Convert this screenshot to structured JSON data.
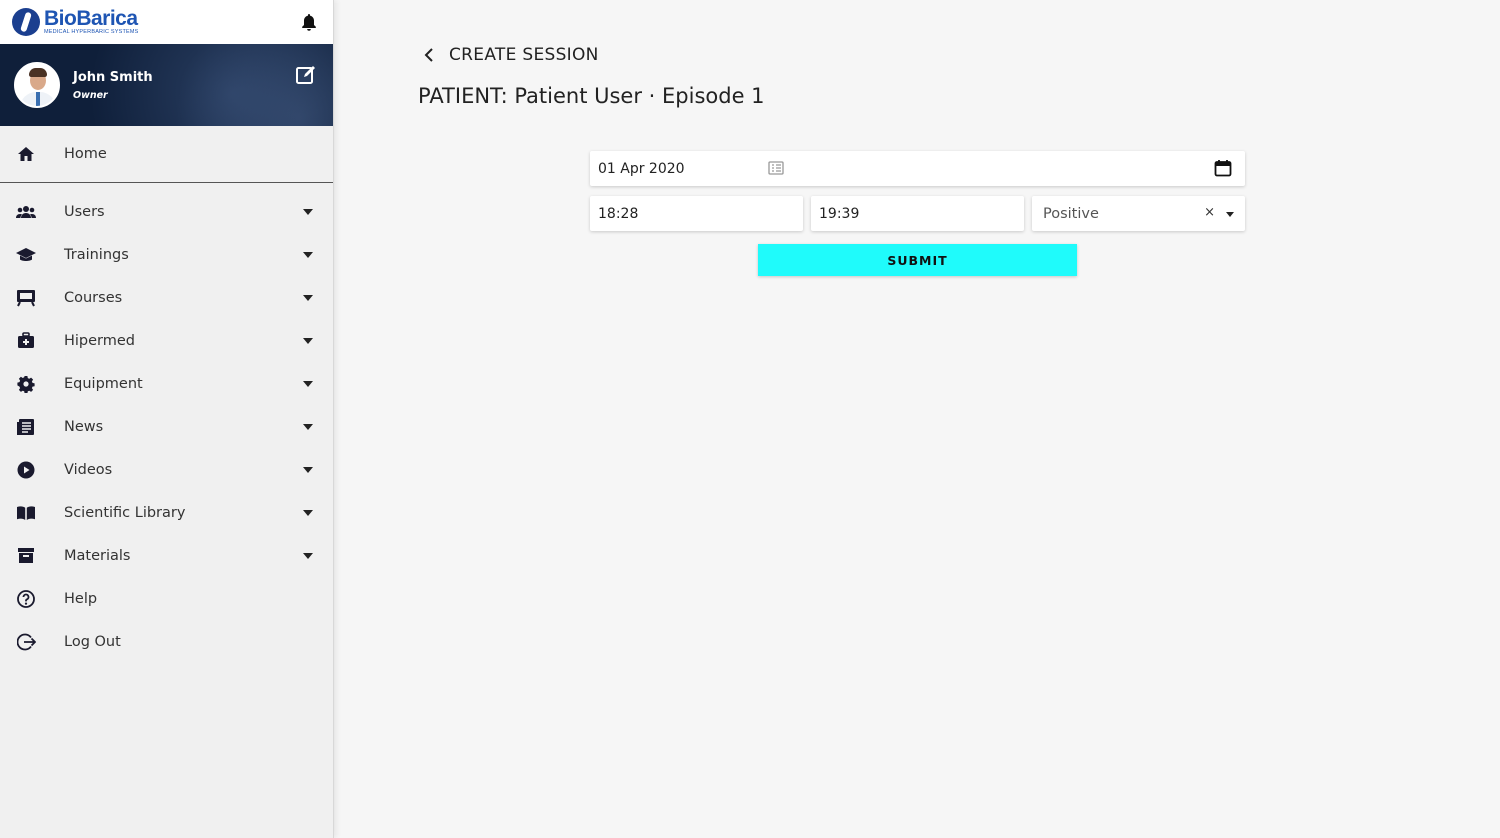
{
  "brand": {
    "name": "BioBarica",
    "tagline": "MEDICAL HYPERBARIC SYSTEMS",
    "color": "#1e55b3"
  },
  "user": {
    "name": "John Smith",
    "role": "Owner"
  },
  "sidebar": {
    "items": [
      {
        "label": "Home",
        "icon": "home-icon"
      },
      {
        "label": "Users",
        "icon": "users-icon"
      },
      {
        "label": "Trainings",
        "icon": "graduation-cap-icon"
      },
      {
        "label": "Courses",
        "icon": "chalkboard-icon"
      },
      {
        "label": "Hipermed",
        "icon": "medical-kit-icon"
      },
      {
        "label": "Equipment",
        "icon": "gear-icon"
      },
      {
        "label": "News",
        "icon": "newspaper-icon"
      },
      {
        "label": "Videos",
        "icon": "play-circle-icon"
      },
      {
        "label": "Scientific Library",
        "icon": "book-icon"
      },
      {
        "label": "Materials",
        "icon": "archive-icon"
      },
      {
        "label": "Help",
        "icon": "question-circle-icon"
      },
      {
        "label": "Log Out",
        "icon": "logout-icon"
      }
    ]
  },
  "main": {
    "breadcrumb": "CREATE SESSION",
    "title": "PATIENT: Patient User · Episode 1"
  },
  "form": {
    "date": "01 Apr 2020",
    "start_time": "18:28",
    "end_time": "19:39",
    "result": "Positive",
    "clear_symbol": "×",
    "submit_label": "SUBMIT",
    "submit_color": "#1ffbfb"
  }
}
